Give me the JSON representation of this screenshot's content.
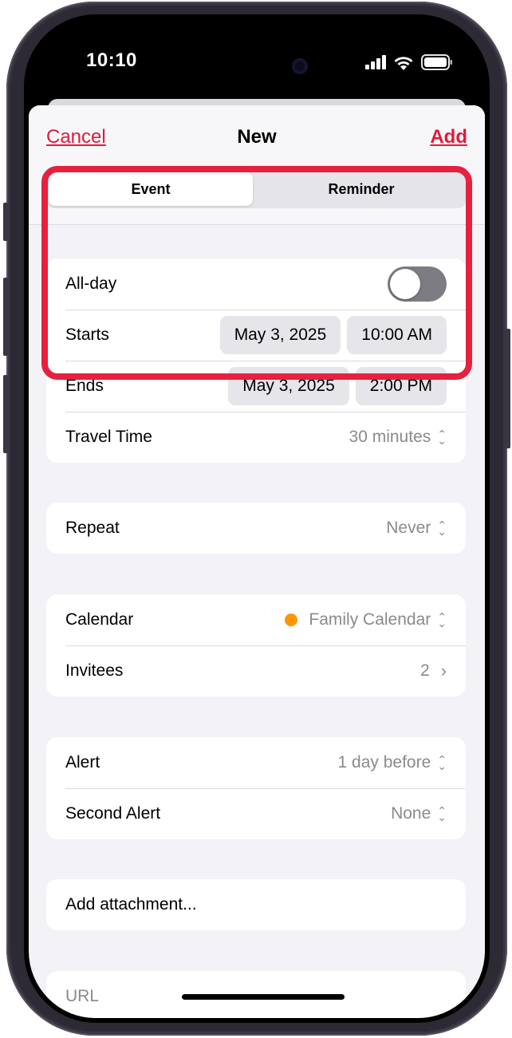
{
  "status_bar": {
    "time": "10:10"
  },
  "nav": {
    "cancel": "Cancel",
    "title": "New",
    "add": "Add"
  },
  "segments": {
    "event": "Event",
    "reminder": "Reminder"
  },
  "time_group": {
    "all_day_label": "All-day",
    "all_day_on": false,
    "starts_label": "Starts",
    "starts_date": "May 3, 2025",
    "starts_time": "10:00 AM",
    "ends_label": "Ends",
    "ends_date": "May 3, 2025",
    "ends_time": "2:00 PM",
    "travel_label": "Travel Time",
    "travel_value": "30 minutes"
  },
  "repeat": {
    "label": "Repeat",
    "value": "Never"
  },
  "calendar_group": {
    "calendar_label": "Calendar",
    "calendar_value": "Family Calendar",
    "calendar_color": "#FF9500",
    "invitees_label": "Invitees",
    "invitees_value": "2"
  },
  "alert_group": {
    "alert_label": "Alert",
    "alert_value": "1 day before",
    "second_label": "Second Alert",
    "second_value": "None"
  },
  "attachment": {
    "label": "Add attachment..."
  },
  "url": {
    "placeholder": "URL"
  },
  "colors": {
    "accent": "#E11A3A",
    "highlight": "#E6213F"
  }
}
